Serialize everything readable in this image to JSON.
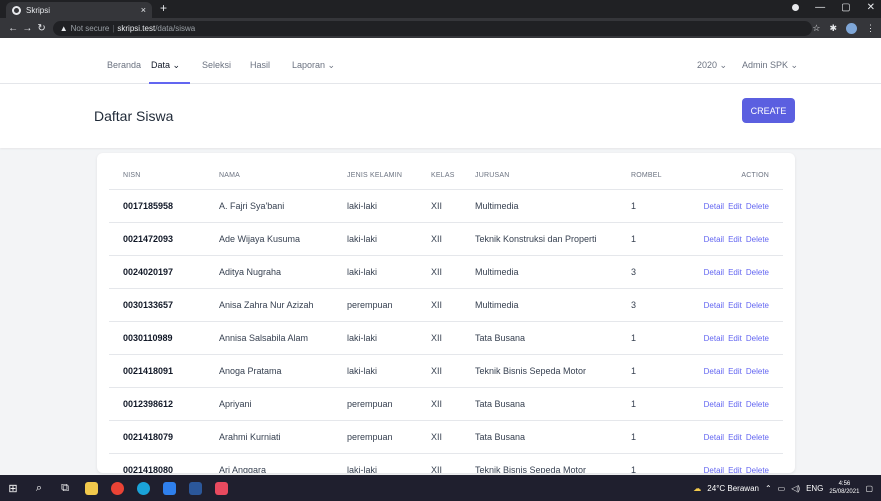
{
  "browser": {
    "tab_title": "Skripsi",
    "tab_close": "×",
    "new_tab": "+",
    "not_secure": "Not secure",
    "separator": "|",
    "url_host": "skripsi.test",
    "url_path": "/data/siswa"
  },
  "nav": {
    "items": [
      {
        "label": "Beranda"
      },
      {
        "label": "Data ⌄"
      },
      {
        "label": "Seleksi"
      },
      {
        "label": "Hasil"
      },
      {
        "label": "Laporan ⌄"
      }
    ],
    "year": "2020 ⌄",
    "user": "Admin SPK ⌄"
  },
  "page": {
    "title": "Daftar Siswa",
    "create_label": "CREATE"
  },
  "table": {
    "headers": [
      "NISN",
      "NAMA",
      "JENIS KELAMIN",
      "KELAS",
      "JURUSAN",
      "ROMBEL",
      "ACTION"
    ],
    "rows": [
      {
        "nisn": "0017185958",
        "nama": "A. Fajri Sya'bani",
        "jk": "laki-laki",
        "kelas": "XII",
        "jurusan": "Multimedia",
        "rombel": "1"
      },
      {
        "nisn": "0021472093",
        "nama": "Ade Wijaya Kusuma",
        "jk": "laki-laki",
        "kelas": "XII",
        "jurusan": "Teknik Konstruksi dan Properti",
        "rombel": "1"
      },
      {
        "nisn": "0024020197",
        "nama": "Aditya Nugraha",
        "jk": "laki-laki",
        "kelas": "XII",
        "jurusan": "Multimedia",
        "rombel": "3"
      },
      {
        "nisn": "0030133657",
        "nama": "Anisa Zahra Nur Azizah",
        "jk": "perempuan",
        "kelas": "XII",
        "jurusan": "Multimedia",
        "rombel": "3"
      },
      {
        "nisn": "0030110989",
        "nama": "Annisa Salsabila Alam",
        "jk": "laki-laki",
        "kelas": "XII",
        "jurusan": "Tata Busana",
        "rombel": "1"
      },
      {
        "nisn": "0021418091",
        "nama": "Anoga Pratama",
        "jk": "laki-laki",
        "kelas": "XII",
        "jurusan": "Teknik Bisnis Sepeda Motor",
        "rombel": "1"
      },
      {
        "nisn": "0012398612",
        "nama": "Apriyani",
        "jk": "perempuan",
        "kelas": "XII",
        "jurusan": "Tata Busana",
        "rombel": "1"
      },
      {
        "nisn": "0021418079",
        "nama": "Arahmi Kurniati",
        "jk": "perempuan",
        "kelas": "XII",
        "jurusan": "Tata Busana",
        "rombel": "1"
      },
      {
        "nisn": "0021418080",
        "nama": "Ari Anggara",
        "jk": "laki-laki",
        "kelas": "XII",
        "jurusan": "Teknik Bisnis Sepeda Motor",
        "rombel": "1"
      }
    ],
    "actions": {
      "detail": "Detail",
      "edit": "Edit",
      "delete": "Delete"
    }
  },
  "taskbar": {
    "weather": "24°C Berawan",
    "lang": "ENG",
    "time": "4:56",
    "date": "25/08/2021"
  },
  "colors": {
    "accent": "#5b5fe0",
    "link": "#6366f1",
    "chrome_dark": "#202124",
    "taskbar": "#1f1f2e"
  }
}
